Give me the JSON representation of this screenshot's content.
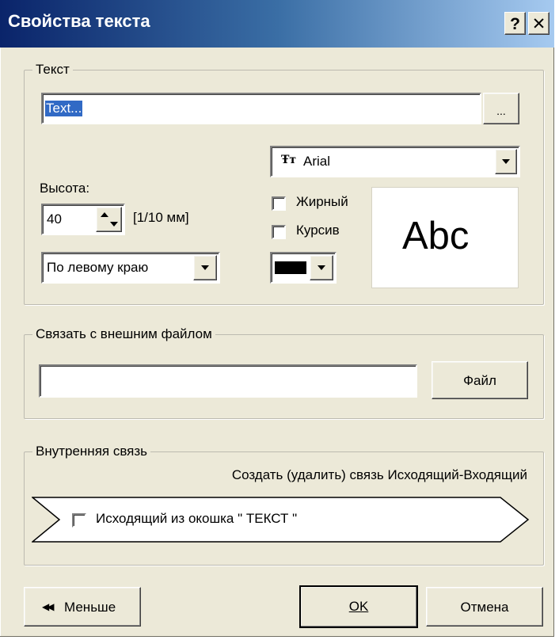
{
  "window": {
    "title": "Свойства текста",
    "help_label": "?",
    "close_label": "✕"
  },
  "text_group": {
    "legend": "Текст",
    "text_value": "Text...",
    "browse_label": "...",
    "height_label": "Высота:",
    "height_value": "40",
    "height_unit": "[1/10 мм]",
    "align_value": "По левому краю",
    "font_icon": "Ŧт",
    "font_value": "Arial",
    "bold_label": "Жирный",
    "bold_checked": false,
    "italic_label": "Курсив",
    "italic_checked": false,
    "color_value": "#000000",
    "preview_text": "Abc"
  },
  "file_group": {
    "legend": "Связать с внешним файлом",
    "file_value": "",
    "file_button": "Файл"
  },
  "link_group": {
    "legend": "Внутренняя связь",
    "caption": "Создать (удалить) связь Исходящий-Входящий",
    "outgoing_label": "Исходящий из окошка \" ТЕКСТ \"",
    "outgoing_checked": false
  },
  "footer": {
    "less_icon": "◀◀",
    "less_label": "Меньше",
    "ok_label": "OK",
    "cancel_label": "Отмена"
  }
}
